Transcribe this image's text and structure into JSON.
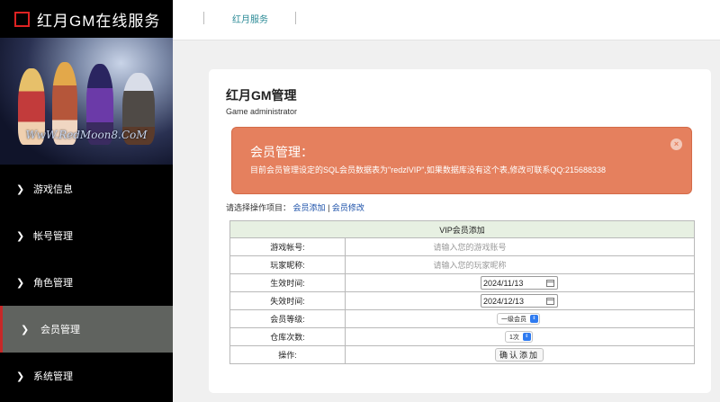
{
  "app": {
    "title": "红月GM在线服务"
  },
  "banner": {
    "watermark": "WwW.RedMoon8.CoM"
  },
  "sidebar": {
    "items": [
      {
        "label": "游戏信息"
      },
      {
        "label": "帐号管理"
      },
      {
        "label": "角色管理"
      },
      {
        "label": "会员管理",
        "active": true
      },
      {
        "label": "系统管理"
      }
    ]
  },
  "topbar": {
    "crumb": "红月服务"
  },
  "page": {
    "title": "红月GM管理",
    "subtitle": "Game administrator"
  },
  "alert": {
    "title": "会员管理：",
    "text": "目前会员管理设定的SQL会员数据表为\"redzlVIP\",如果数据库没有这个表,修改可联系QQ:215688338",
    "close": "×",
    "color": "#e5805e"
  },
  "ops": {
    "prompt": "请选择操作项目：",
    "link_add": "会员添加",
    "divider": "|",
    "link_edit": "会员修改"
  },
  "form": {
    "header": "VIP会员添加",
    "account_label": "游戏帐号:",
    "account_placeholder": "请输入您的游戏账号",
    "nick_label": "玩家昵称:",
    "nick_placeholder": "请输入您的玩家昵称",
    "start_label": "生效时间:",
    "start_value": "2024/11/13",
    "end_label": "失效时间:",
    "end_value": "2024/12/13",
    "level_label": "会员等级:",
    "level_value": "一级会员",
    "warehouse_label": "仓库次数:",
    "warehouse_value": "1次",
    "action_label": "操作:",
    "submit": "确认添加"
  }
}
